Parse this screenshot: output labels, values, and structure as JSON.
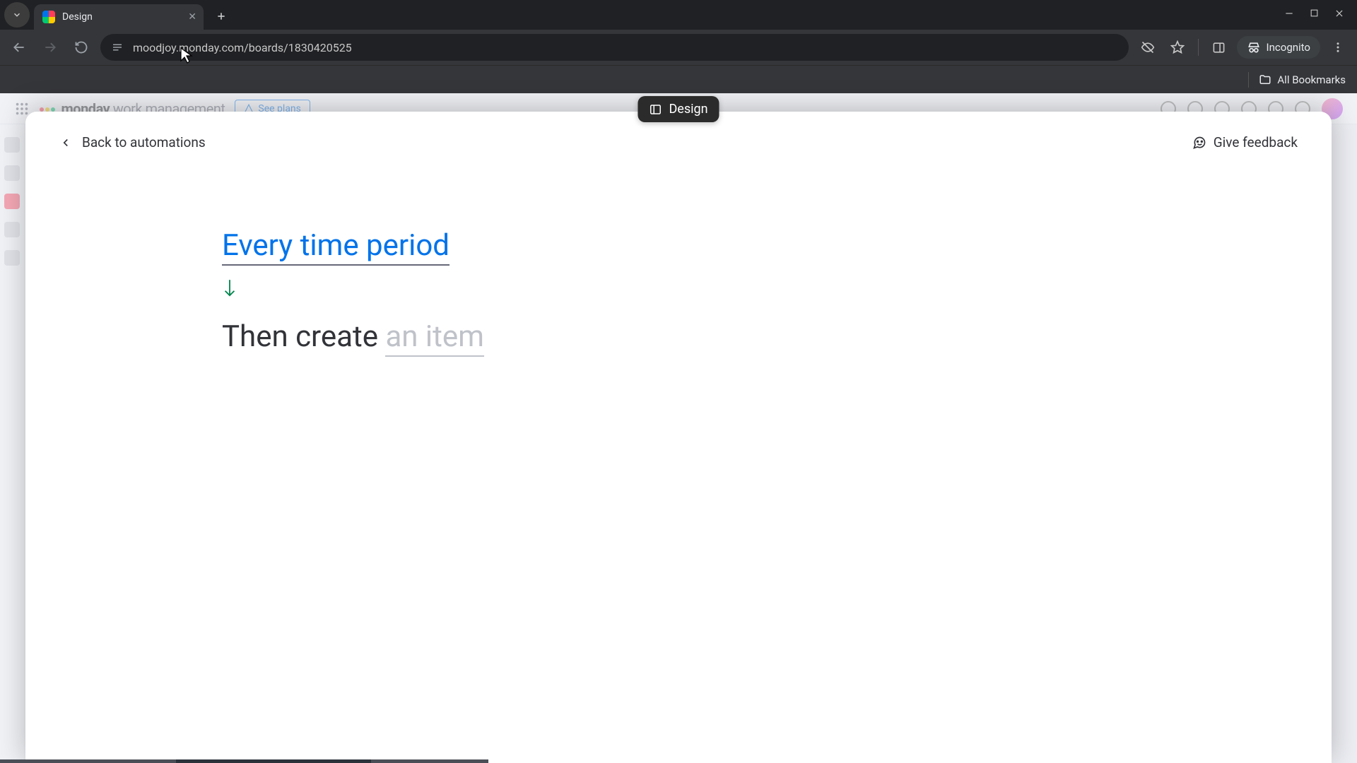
{
  "browser": {
    "tab_title": "Design",
    "url": "moodjoy.monday.com/boards/1830420525",
    "incognito_label": "Incognito",
    "all_bookmarks": "All Bookmarks"
  },
  "background": {
    "app_name": "monday",
    "app_suffix": "work management",
    "see_plans": "See plans"
  },
  "pill": {
    "label": "Design"
  },
  "modal": {
    "back_label": "Back to automations",
    "feedback_label": "Give feedback",
    "trigger_text": "Every time period",
    "action_prefix": "Then create ",
    "action_placeholder": "an item"
  }
}
